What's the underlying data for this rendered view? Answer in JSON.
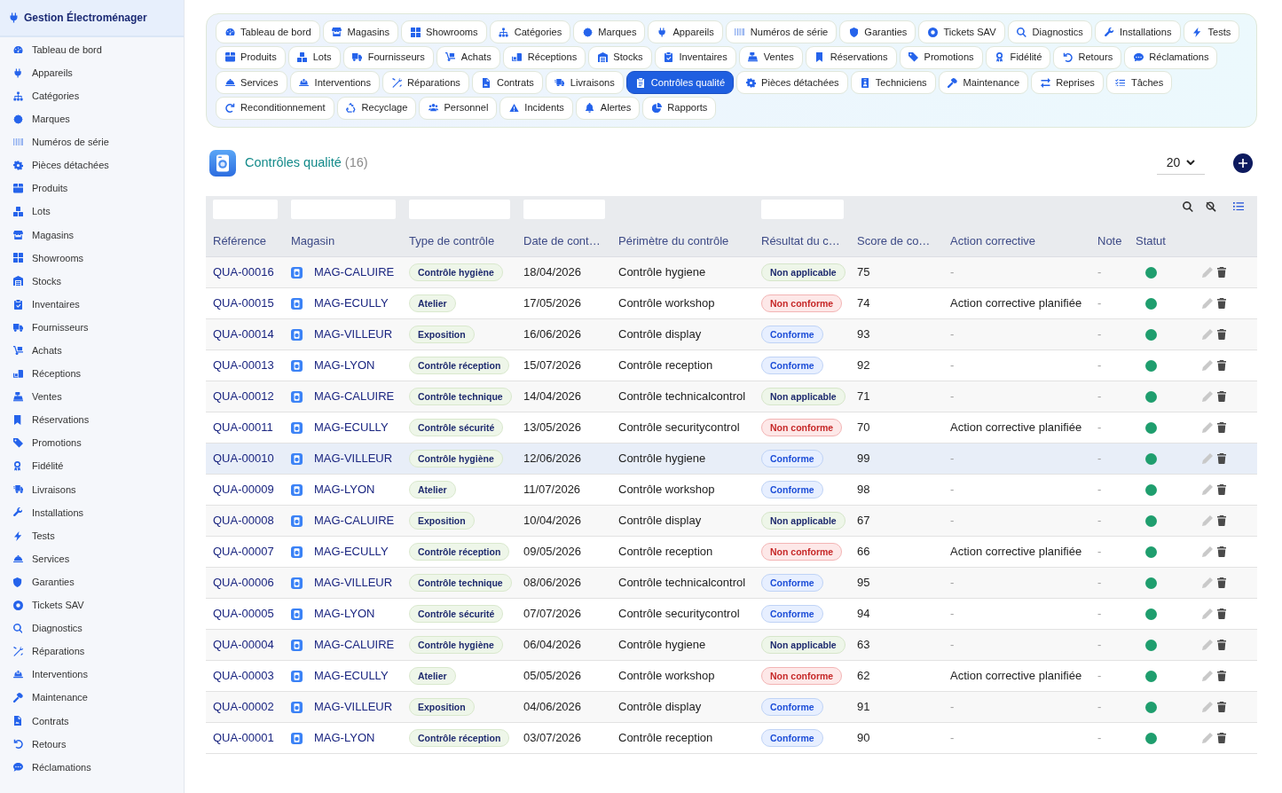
{
  "sidebar": {
    "title": "Gestion Électroménager",
    "items": [
      {
        "label": "Tableau de bord",
        "selected": false
      },
      {
        "label": "Appareils",
        "selected": false
      },
      {
        "label": "Catégories",
        "selected": false
      },
      {
        "label": "Marques",
        "selected": false
      },
      {
        "label": "Numéros de série",
        "selected": false
      },
      {
        "label": "Pièces détachées",
        "selected": false
      },
      {
        "label": "Produits",
        "selected": false
      },
      {
        "label": "Lots",
        "selected": false
      },
      {
        "label": "Magasins",
        "selected": false
      },
      {
        "label": "Showrooms",
        "selected": false
      },
      {
        "label": "Stocks",
        "selected": false
      },
      {
        "label": "Inventaires",
        "selected": false
      },
      {
        "label": "Fournisseurs",
        "selected": false
      },
      {
        "label": "Achats",
        "selected": false
      },
      {
        "label": "Réceptions",
        "selected": false
      },
      {
        "label": "Ventes",
        "selected": false
      },
      {
        "label": "Réservations",
        "selected": false
      },
      {
        "label": "Promotions",
        "selected": false
      },
      {
        "label": "Fidélité",
        "selected": false
      },
      {
        "label": "Livraisons",
        "selected": false
      },
      {
        "label": "Installations",
        "selected": false
      },
      {
        "label": "Tests",
        "selected": false
      },
      {
        "label": "Services",
        "selected": false
      },
      {
        "label": "Garanties",
        "selected": false
      },
      {
        "label": "Tickets SAV",
        "selected": false
      },
      {
        "label": "Diagnostics",
        "selected": false
      },
      {
        "label": "Réparations",
        "selected": false
      },
      {
        "label": "Interventions",
        "selected": false
      },
      {
        "label": "Maintenance",
        "selected": false
      },
      {
        "label": "Contrats",
        "selected": false
      },
      {
        "label": "Retours",
        "selected": false
      },
      {
        "label": "Réclamations",
        "selected": false
      }
    ]
  },
  "nav": {
    "tabs": [
      {
        "label": "Tableau de bord",
        "selected": false
      },
      {
        "label": "Magasins",
        "selected": false
      },
      {
        "label": "Showrooms",
        "selected": false
      },
      {
        "label": "Catégories",
        "selected": false
      },
      {
        "label": "Marques",
        "selected": false
      },
      {
        "label": "Appareils",
        "selected": false
      },
      {
        "label": "Numéros de série",
        "selected": false
      },
      {
        "label": "Garanties",
        "selected": false
      },
      {
        "label": "Tickets SAV",
        "selected": false
      },
      {
        "label": "Diagnostics",
        "selected": false
      },
      {
        "label": "Installations",
        "selected": false
      },
      {
        "label": "Tests",
        "selected": false
      },
      {
        "label": "Produits",
        "selected": false
      },
      {
        "label": "Lots",
        "selected": false
      },
      {
        "label": "Fournisseurs",
        "selected": false
      },
      {
        "label": "Achats",
        "selected": false
      },
      {
        "label": "Réceptions",
        "selected": false
      },
      {
        "label": "Stocks",
        "selected": false
      },
      {
        "label": "Inventaires",
        "selected": false
      },
      {
        "label": "Ventes",
        "selected": false
      },
      {
        "label": "Réservations",
        "selected": false
      },
      {
        "label": "Promotions",
        "selected": false
      },
      {
        "label": "Fidélité",
        "selected": false
      },
      {
        "label": "Retours",
        "selected": false
      },
      {
        "label": "Réclamations",
        "selected": false
      },
      {
        "label": "Services",
        "selected": false
      },
      {
        "label": "Interventions",
        "selected": false
      },
      {
        "label": "Réparations",
        "selected": false
      },
      {
        "label": "Contrats",
        "selected": false
      },
      {
        "label": "Livraisons",
        "selected": false
      },
      {
        "label": "Contrôles qualité",
        "selected": true
      },
      {
        "label": "Pièces détachées",
        "selected": false
      },
      {
        "label": "Techniciens",
        "selected": false
      },
      {
        "label": "Maintenance",
        "selected": false
      },
      {
        "label": "Reprises",
        "selected": false
      },
      {
        "label": "Tâches",
        "selected": false
      },
      {
        "label": "Reconditionnement",
        "selected": false
      },
      {
        "label": "Recyclage",
        "selected": false
      },
      {
        "label": "Personnel",
        "selected": false
      },
      {
        "label": "Incidents",
        "selected": false
      },
      {
        "label": "Alertes",
        "selected": false
      },
      {
        "label": "Rapports",
        "selected": false
      }
    ]
  },
  "header": {
    "title": "Contrôles qualité",
    "count": "(16)",
    "page_size": "20"
  },
  "table": {
    "columns": [
      {
        "label": "Référence",
        "filterable": true
      },
      {
        "label": "Magasin",
        "filterable": true
      },
      {
        "label": "Type de contrôle",
        "filterable": true
      },
      {
        "label": "Date de cont…",
        "filterable": true
      },
      {
        "label": "Périmètre du contrôle",
        "filterable": false
      },
      {
        "label": "Résultat du c…",
        "filterable": true
      },
      {
        "label": "Score de co…",
        "filterable": false
      },
      {
        "label": "Action corrective",
        "filterable": false
      },
      {
        "label": "Note",
        "filterable": false
      },
      {
        "label": "Statut",
        "filterable": false
      }
    ],
    "rows": [
      {
        "reference": "QUA-00016",
        "store": "MAG-CALUIRE",
        "type": "Contrôle hygiène",
        "date": "18/04/2026",
        "scope": "Contrôle hygiene",
        "result": {
          "label": "Non applicable",
          "kind": "neutral"
        },
        "score": "75",
        "action": {
          "text": "-",
          "muted": true
        },
        "note": "-",
        "status": {
          "color": "#1f9e6e"
        },
        "selected": false
      },
      {
        "reference": "QUA-00015",
        "store": "MAG-ECULLY",
        "type": "Atelier",
        "date": "17/05/2026",
        "scope": "Contrôle workshop",
        "result": {
          "label": "Non conforme",
          "kind": "danger"
        },
        "score": "74",
        "action": {
          "text": "Action corrective planifiée",
          "muted": false
        },
        "note": "-",
        "status": {
          "color": "#1f9e6e"
        },
        "selected": false
      },
      {
        "reference": "QUA-00014",
        "store": "MAG-VILLEUR",
        "type": "Exposition",
        "date": "16/06/2026",
        "scope": "Contrôle display",
        "result": {
          "label": "Conforme",
          "kind": "info"
        },
        "score": "93",
        "action": {
          "text": "-",
          "muted": true
        },
        "note": "-",
        "status": {
          "color": "#1f9e6e"
        },
        "selected": false
      },
      {
        "reference": "QUA-00013",
        "store": "MAG-LYON",
        "type": "Contrôle réception",
        "date": "15/07/2026",
        "scope": "Contrôle reception",
        "result": {
          "label": "Conforme",
          "kind": "info"
        },
        "score": "92",
        "action": {
          "text": "-",
          "muted": true
        },
        "note": "-",
        "status": {
          "color": "#1f9e6e"
        },
        "selected": false
      },
      {
        "reference": "QUA-00012",
        "store": "MAG-CALUIRE",
        "type": "Contrôle technique",
        "date": "14/04/2026",
        "scope": "Contrôle technicalcontrol",
        "result": {
          "label": "Non applicable",
          "kind": "neutral"
        },
        "score": "71",
        "action": {
          "text": "-",
          "muted": true
        },
        "note": "-",
        "status": {
          "color": "#1f9e6e"
        },
        "selected": false
      },
      {
        "reference": "QUA-00011",
        "store": "MAG-ECULLY",
        "type": "Contrôle sécurité",
        "date": "13/05/2026",
        "scope": "Contrôle securitycontrol",
        "result": {
          "label": "Non conforme",
          "kind": "danger"
        },
        "score": "70",
        "action": {
          "text": "Action corrective planifiée",
          "muted": false
        },
        "note": "-",
        "status": {
          "color": "#1f9e6e"
        },
        "selected": false
      },
      {
        "reference": "QUA-00010",
        "store": "MAG-VILLEUR",
        "type": "Contrôle hygiène",
        "date": "12/06/2026",
        "scope": "Contrôle hygiene",
        "result": {
          "label": "Conforme",
          "kind": "info"
        },
        "score": "99",
        "action": {
          "text": "-",
          "muted": true
        },
        "note": "-",
        "status": {
          "color": "#1f9e6e"
        },
        "selected": true
      },
      {
        "reference": "QUA-00009",
        "store": "MAG-LYON",
        "type": "Atelier",
        "date": "11/07/2026",
        "scope": "Contrôle workshop",
        "result": {
          "label": "Conforme",
          "kind": "info"
        },
        "score": "98",
        "action": {
          "text": "-",
          "muted": true
        },
        "note": "-",
        "status": {
          "color": "#1f9e6e"
        },
        "selected": false
      },
      {
        "reference": "QUA-00008",
        "store": "MAG-CALUIRE",
        "type": "Exposition",
        "date": "10/04/2026",
        "scope": "Contrôle display",
        "result": {
          "label": "Non applicable",
          "kind": "neutral"
        },
        "score": "67",
        "action": {
          "text": "-",
          "muted": true
        },
        "note": "-",
        "status": {
          "color": "#1f9e6e"
        },
        "selected": false
      },
      {
        "reference": "QUA-00007",
        "store": "MAG-ECULLY",
        "type": "Contrôle réception",
        "date": "09/05/2026",
        "scope": "Contrôle reception",
        "result": {
          "label": "Non conforme",
          "kind": "danger"
        },
        "score": "66",
        "action": {
          "text": "Action corrective planifiée",
          "muted": false
        },
        "note": "-",
        "status": {
          "color": "#1f9e6e"
        },
        "selected": false
      },
      {
        "reference": "QUA-00006",
        "store": "MAG-VILLEUR",
        "type": "Contrôle technique",
        "date": "08/06/2026",
        "scope": "Contrôle technicalcontrol",
        "result": {
          "label": "Conforme",
          "kind": "info"
        },
        "score": "95",
        "action": {
          "text": "-",
          "muted": true
        },
        "note": "-",
        "status": {
          "color": "#1f9e6e"
        },
        "selected": false
      },
      {
        "reference": "QUA-00005",
        "store": "MAG-LYON",
        "type": "Contrôle sécurité",
        "date": "07/07/2026",
        "scope": "Contrôle securitycontrol",
        "result": {
          "label": "Conforme",
          "kind": "info"
        },
        "score": "94",
        "action": {
          "text": "-",
          "muted": true
        },
        "note": "-",
        "status": {
          "color": "#1f9e6e"
        },
        "selected": false
      },
      {
        "reference": "QUA-00004",
        "store": "MAG-CALUIRE",
        "type": "Contrôle hygiène",
        "date": "06/04/2026",
        "scope": "Contrôle hygiene",
        "result": {
          "label": "Non applicable",
          "kind": "neutral"
        },
        "score": "63",
        "action": {
          "text": "-",
          "muted": true
        },
        "note": "-",
        "status": {
          "color": "#1f9e6e"
        },
        "selected": false
      },
      {
        "reference": "QUA-00003",
        "store": "MAG-ECULLY",
        "type": "Atelier",
        "date": "05/05/2026",
        "scope": "Contrôle workshop",
        "result": {
          "label": "Non conforme",
          "kind": "danger"
        },
        "score": "62",
        "action": {
          "text": "Action corrective planifiée",
          "muted": false
        },
        "note": "-",
        "status": {
          "color": "#1f9e6e"
        },
        "selected": false
      },
      {
        "reference": "QUA-00002",
        "store": "MAG-VILLEUR",
        "type": "Exposition",
        "date": "04/06/2026",
        "scope": "Contrôle display",
        "result": {
          "label": "Conforme",
          "kind": "info"
        },
        "score": "91",
        "action": {
          "text": "-",
          "muted": true
        },
        "note": "-",
        "status": {
          "color": "#1f9e6e"
        },
        "selected": false
      },
      {
        "reference": "QUA-00001",
        "store": "MAG-LYON",
        "type": "Contrôle réception",
        "date": "03/07/2026",
        "scope": "Contrôle reception",
        "result": {
          "label": "Conforme",
          "kind": "info"
        },
        "score": "90",
        "action": {
          "text": "-",
          "muted": true
        },
        "note": "-",
        "status": {
          "color": "#1f9e6e"
        },
        "selected": false
      }
    ]
  }
}
